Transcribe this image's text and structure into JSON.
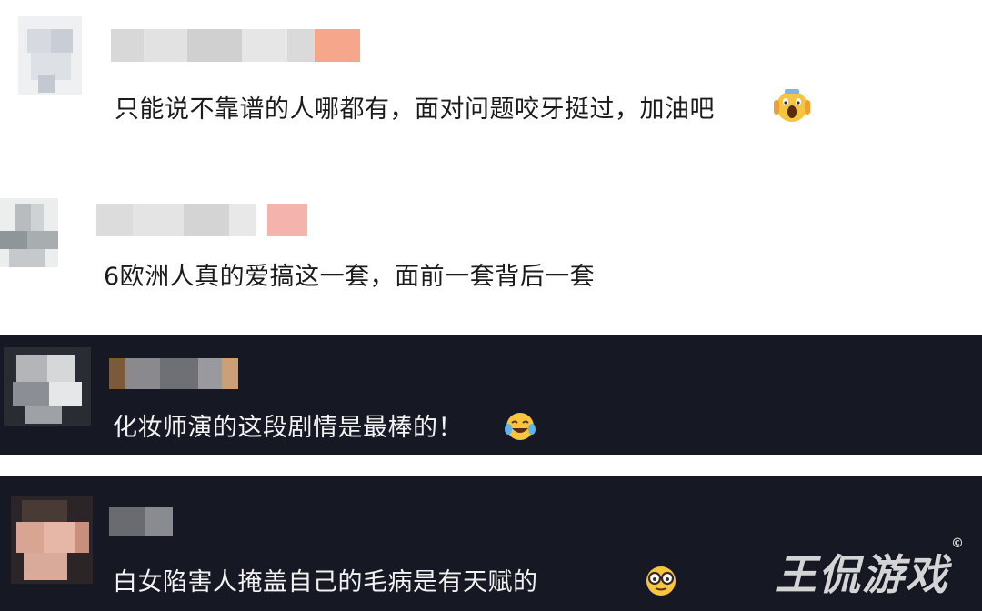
{
  "comments": [
    {
      "text": "只能说不靠谱的人哪都有，面对问题咬牙挺过，加油吧",
      "emoji": "face-screaming-emoji"
    },
    {
      "text": "6欧洲人真的爱搞这一套，面前一套背后一套",
      "emoji": ""
    },
    {
      "text": "化妆师演的这段剧情是最棒的！",
      "emoji": "face-tears-of-joy-emoji"
    },
    {
      "text": "白女陷害人掩盖自己的毛病是有天赋的",
      "emoji": "face-with-glasses-emoji"
    }
  ],
  "watermark": {
    "text": "王侃游戏",
    "mark": "©"
  },
  "colors": {
    "dark_bg": "#161823",
    "light_bg": "#ffffff"
  }
}
